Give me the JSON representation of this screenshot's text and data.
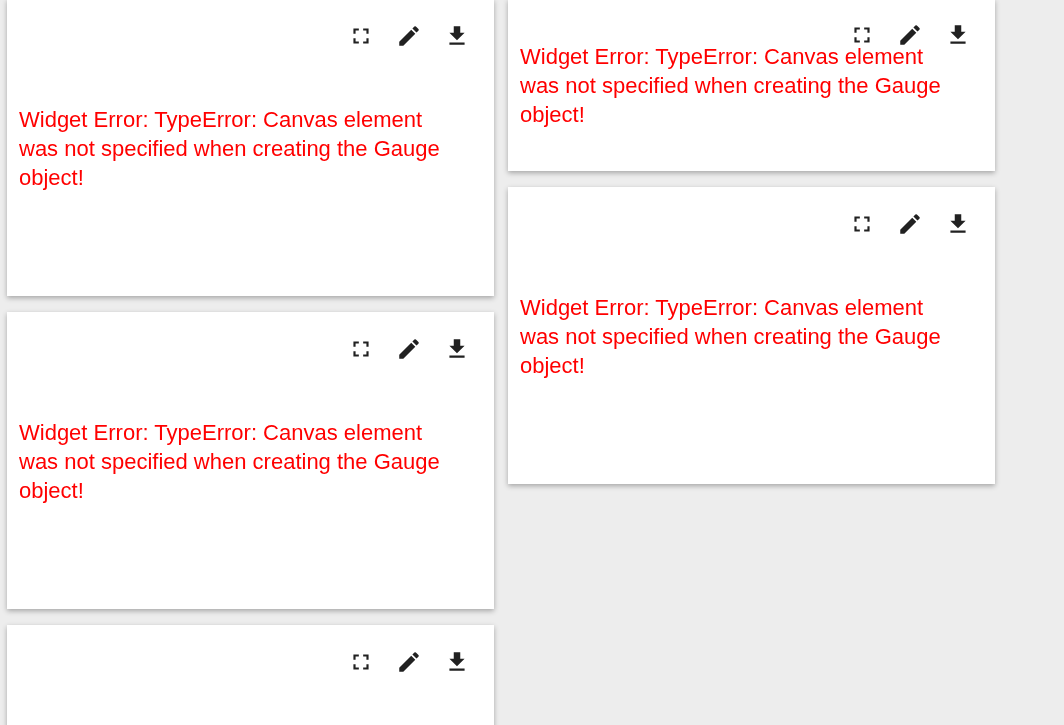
{
  "columns": [
    {
      "cards": [
        {
          "buttons": [
            {
              "kind": "fullscreen"
            },
            {
              "kind": "edit"
            },
            {
              "kind": "download"
            }
          ],
          "message": "Widget Error: TypeError: Canvas element was not specified when creating the Gauge object!"
        },
        {
          "buttons": [
            {
              "kind": "fullscreen"
            },
            {
              "kind": "edit"
            },
            {
              "kind": "download"
            }
          ],
          "message": "Widget Error: TypeError: Canvas element was not specified when creating the Gauge object!"
        },
        {
          "buttons": [
            {
              "kind": "fullscreen"
            },
            {
              "kind": "edit"
            },
            {
              "kind": "download"
            }
          ]
        }
      ]
    },
    {
      "cards": [
        {
          "buttons": [
            {
              "kind": "fullscreen"
            },
            {
              "kind": "edit"
            },
            {
              "kind": "download"
            }
          ],
          "message": "Widget Error: TypeError: Canvas element was not specified when creating the Gauge object!"
        },
        {
          "buttons": [
            {
              "kind": "fullscreen"
            },
            {
              "kind": "edit"
            },
            {
              "kind": "download"
            }
          ],
          "message": "Widget Error: TypeError: Canvas element was not specified when creating the Gauge object!"
        }
      ]
    }
  ]
}
